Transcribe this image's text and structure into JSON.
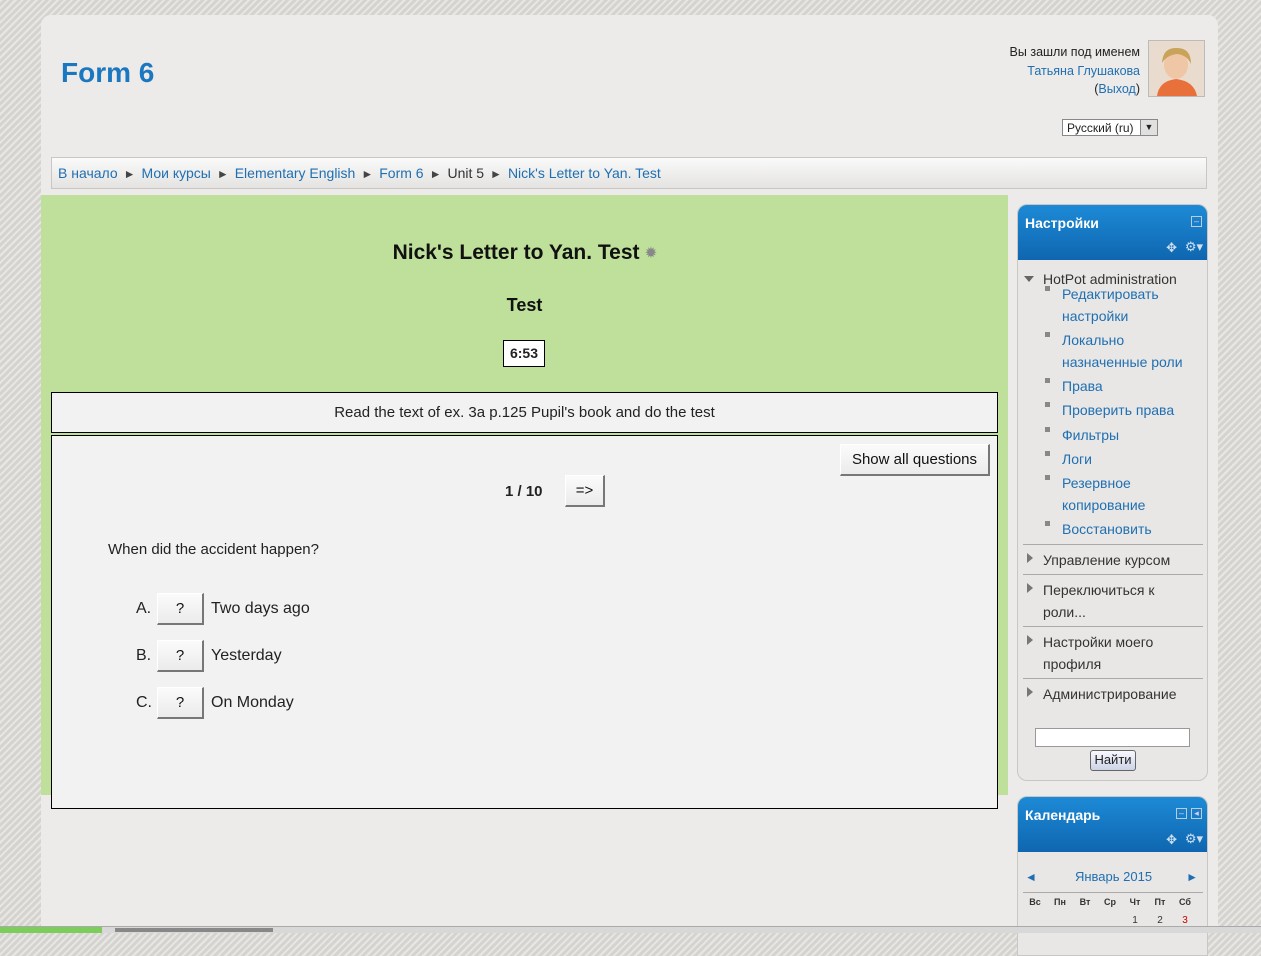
{
  "header": {
    "site_title": "Form 6",
    "login_prefix": "Вы зашли под именем",
    "user_name": "Татьяна Глушакова",
    "logout_open": "(",
    "logout_label": "Выход",
    "logout_close": ")",
    "language": "Русский (ru)"
  },
  "breadcrumb": {
    "items": [
      "В начало",
      "Мои курсы",
      "Elementary English",
      "Form 6",
      "Unit 5",
      "Nick's Letter to Yan. Test"
    ],
    "separator": "►"
  },
  "quiz": {
    "title": "Nick's Letter to Yan. Test",
    "subtitle": "Test",
    "timer": "6:53",
    "instructions": "Read the text of ex. 3a p.125 Pupil's book and do the test",
    "show_all_label": "Show all questions",
    "counter": "1 / 10",
    "next_label": "=>",
    "question": "When did the accident happen?",
    "answers": [
      {
        "letter": "A.",
        "button": "?",
        "text": "Two days ago"
      },
      {
        "letter": "B.",
        "button": "?",
        "text": "Yesterday"
      },
      {
        "letter": "C.",
        "button": "?",
        "text": "On Monday"
      }
    ]
  },
  "settings_block": {
    "title": "Настройки",
    "hotpot_label": "HotPot administration",
    "items": [
      "Редактировать настройки",
      "Локально назначенные роли",
      "Права",
      "Проверить права",
      "Фильтры",
      "Логи",
      "Резервное копирование",
      "Восстановить"
    ],
    "sections": [
      "Управление курсом",
      "Переключиться к роли...",
      "Настройки моего профиля",
      "Администрирование"
    ],
    "search_button": "Найти"
  },
  "calendar_block": {
    "title": "Календарь",
    "prev": "◄",
    "next": "►",
    "month": "Январь 2015",
    "weekdays": [
      "Вс",
      "Пн",
      "Вт",
      "Ср",
      "Чт",
      "Пт",
      "Сб"
    ],
    "first_days": [
      "1",
      "2",
      "3"
    ],
    "weekend_color": "#cc0000"
  },
  "colors": {
    "main_bg": "#bfe09a",
    "link": "#1f6fb2",
    "block_header": "#1378c4"
  }
}
